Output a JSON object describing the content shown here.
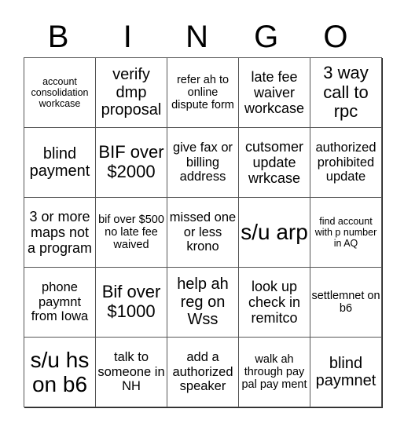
{
  "header": {
    "letters": [
      "B",
      "I",
      "N",
      "G",
      "O"
    ]
  },
  "card": {
    "rows": [
      [
        "account consolidation workcase",
        "verify dmp proposal",
        "refer ah to online dispute form",
        "late fee waiver workcase",
        "3 way call to rpc"
      ],
      [
        "blind payment",
        "BIF over $2000",
        "give fax or billing address",
        "cutsomer update wrkcase",
        "authorized prohibited update"
      ],
      [
        "3 or more maps not a program",
        "bif over $500 no late fee waived",
        "missed one or less krono",
        "s/u arp",
        "find account with p number in AQ"
      ],
      [
        "phone paymnt from Iowa",
        "Bif over $1000",
        "help ah reg on Wss",
        "look up check in remitco",
        "settlemnet on b6"
      ],
      [
        "s/u hs on b6",
        "talk to someone in NH",
        "add a authorized speaker",
        "walk ah through pay pal pay ment",
        "blind paymnet"
      ]
    ]
  }
}
